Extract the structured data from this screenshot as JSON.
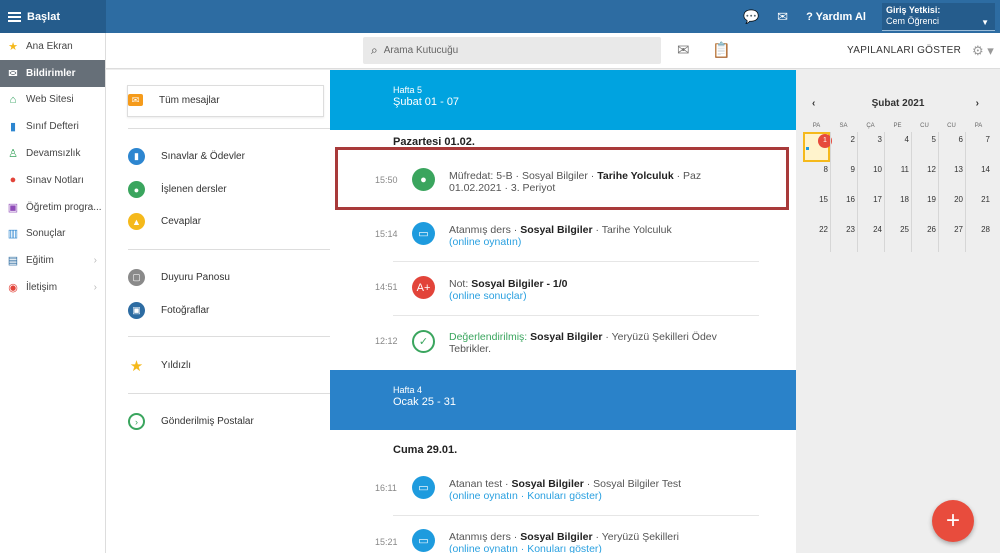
{
  "header": {
    "start": "Başlat",
    "help": "Yardım Al",
    "auth_label": "Giriş Yetkisi:",
    "auth_value": "Cem Öğrenci"
  },
  "sidebar": {
    "items": [
      {
        "label": "Ana Ekran",
        "icon": "star-icon",
        "color": "#f5b91b"
      },
      {
        "label": "Bildirimler",
        "icon": "envelope-icon",
        "color": "#ffffff"
      },
      {
        "label": "Web Sitesi",
        "icon": "home-icon",
        "color": "#2e9f5b"
      },
      {
        "label": "Sınıf Defteri",
        "icon": "notebook-icon",
        "color": "#2d86d0"
      },
      {
        "label": "Devamsızlık",
        "icon": "person-icon",
        "color": "#3aa55e"
      },
      {
        "label": "Sınav Notları",
        "icon": "grade-icon",
        "color": "#e2443a"
      },
      {
        "label": "Öğretim progra...",
        "icon": "program-icon",
        "color": "#8e4bb8"
      },
      {
        "label": "Sonuçlar",
        "icon": "bar-chart-icon",
        "color": "#2d86d0"
      },
      {
        "label": "Eğitim",
        "icon": "briefcase-icon",
        "color": "#2d6ca2"
      },
      {
        "label": "İletişim",
        "icon": "chat-icon",
        "color": "#e2443a"
      }
    ]
  },
  "toolbar": {
    "search_placeholder": "Arama Kutucuğu",
    "show_label": "YAPILANLARI GÖSTER"
  },
  "left_menu": {
    "selected": "Tüm mesajlar",
    "items": [
      {
        "label": "Sınavlar & Ödevler",
        "color": "#2d86d0"
      },
      {
        "label": "İşlenen dersler",
        "color": "#3aa55e"
      },
      {
        "label": "Cevaplar",
        "color": "#f5b91b"
      },
      {
        "label": "Duyuru Panosu",
        "color": "#8a8a8a"
      },
      {
        "label": "Fotoğraflar",
        "color": "#2d6ca2"
      },
      {
        "label": "Yıldızlı",
        "color": "#f5b91b"
      },
      {
        "label": "Gönderilmiş Postalar",
        "color": "#3aa55e"
      }
    ]
  },
  "feed": {
    "week1": {
      "label": "Hafta 5",
      "range": "Şubat 01 - 07"
    },
    "day1": "Pazartesi 01.02.",
    "entries1": [
      {
        "time": "15:50",
        "pre": "Müfredat: 5-B · Sosyal Bilgiler · ",
        "bold": "Tarihe Yolculuk",
        "post": " · Paz",
        "line2": "01.02.2021 · 3. Periyot",
        "link": ""
      },
      {
        "time": "15:14",
        "pre": "Atanmış ders · ",
        "bold": "Sosyal Bilgiler",
        "post": " · Tarihe Yolculuk",
        "line2": "",
        "link": "(online oynatın)"
      },
      {
        "time": "14:51",
        "pre": "Not: ",
        "bold": "Sosyal Bilgiler - 1/0",
        "post": "",
        "line2": "",
        "link": "(online sonuçlar)"
      },
      {
        "time": "12:12",
        "pre": "Değerlendirilmiş: ",
        "bold": "Sosyal Bilgiler",
        "post": " · Yeryüzü Şekilleri Ödev",
        "line2": "Tebrikler.",
        "link": ""
      }
    ],
    "week2": {
      "label": "Hafta 4",
      "range": "Ocak 25 - 31"
    },
    "day2": "Cuma 29.01.",
    "entries2": [
      {
        "time": "16:11",
        "pre": "Atanan test · ",
        "bold": "Sosyal Bilgiler",
        "post": " · Sosyal Bilgiler Test",
        "link": "(online oynatın · Konuları göster)"
      },
      {
        "time": "15:21",
        "pre": "Atanmış ders · ",
        "bold": "Sosyal Bilgiler",
        "post": " · Yeryüzü Şekilleri",
        "link": "(online oynatın · Konuları göster)"
      }
    ]
  },
  "calendar": {
    "month": "Şubat 2021",
    "dow": [
      "PA",
      "SA",
      "ÇA",
      "PE",
      "CU",
      "CU",
      "PA"
    ],
    "weeks": [
      [
        "1",
        "2",
        "3",
        "4",
        "5",
        "6",
        "7"
      ],
      [
        "8",
        "9",
        "10",
        "11",
        "12",
        "13",
        "14"
      ],
      [
        "15",
        "16",
        "17",
        "18",
        "19",
        "20",
        "21"
      ],
      [
        "22",
        "23",
        "24",
        "25",
        "26",
        "27",
        "28"
      ]
    ],
    "badge": "1"
  },
  "colors": {
    "topbar": "#2d6ca2",
    "week1": "#00a3e0",
    "week2": "#2a82c9",
    "fab": "#e84c3d",
    "highlight": "#a83a3a"
  }
}
